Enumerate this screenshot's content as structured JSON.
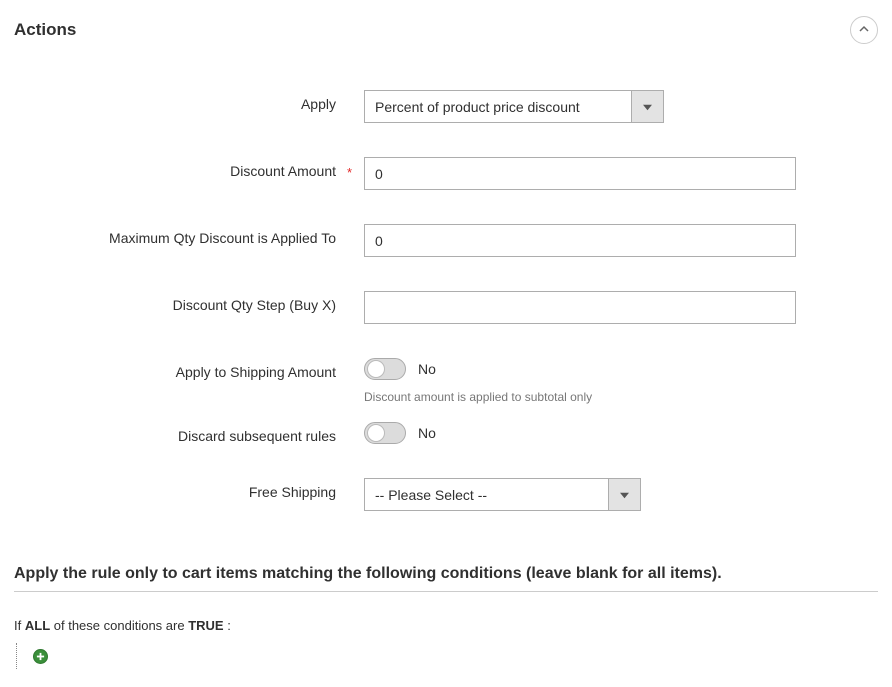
{
  "section_title": "Actions",
  "apply": {
    "label": "Apply",
    "value": "Percent of product price discount"
  },
  "discount_amount": {
    "label": "Discount Amount",
    "value": "0"
  },
  "max_qty": {
    "label": "Maximum Qty Discount is Applied To",
    "value": "0"
  },
  "qty_step": {
    "label": "Discount Qty Step (Buy X)",
    "value": ""
  },
  "apply_shipping": {
    "label": "Apply to Shipping Amount",
    "value": "No",
    "hint": "Discount amount is applied to subtotal only"
  },
  "discard": {
    "label": "Discard subsequent rules",
    "value": "No"
  },
  "free_shipping": {
    "label": "Free Shipping",
    "value": "-- Please Select --"
  },
  "conditions_heading": "Apply the rule only to cart items matching the following conditions (leave blank for all items).",
  "conditions": {
    "prefix": "If",
    "combiner": "ALL",
    "middle": " of these conditions are ",
    "truth": "TRUE",
    "suffix": " :"
  }
}
